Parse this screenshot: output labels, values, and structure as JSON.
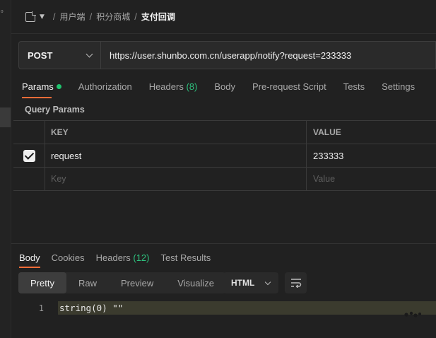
{
  "sidebar": {
    "edge_glyph": "⁰"
  },
  "breadcrumb": {
    "icon": "document-icon",
    "items": [
      "用户端",
      "积分商城",
      "支付回调"
    ],
    "separator": "/"
  },
  "request": {
    "method": "POST",
    "url": "https://user.shunbo.com.cn/userapp/notify?request=233333"
  },
  "request_tabs": [
    {
      "label": "Params",
      "active": true,
      "indicator": "green-dot"
    },
    {
      "label": "Authorization"
    },
    {
      "label": "Headers",
      "count": "(8)"
    },
    {
      "label": "Body"
    },
    {
      "label": "Pre-request Script"
    },
    {
      "label": "Tests"
    },
    {
      "label": "Settings"
    }
  ],
  "params": {
    "section_title": "Query Params",
    "columns": {
      "key": "KEY",
      "value": "VALUE"
    },
    "rows": [
      {
        "checked": true,
        "key": "request",
        "value": "233333"
      }
    ],
    "placeholders": {
      "key": "Key",
      "value": "Value"
    }
  },
  "response_tabs": [
    {
      "label": "Body",
      "active": true
    },
    {
      "label": "Cookies"
    },
    {
      "label": "Headers",
      "count": "(12)"
    },
    {
      "label": "Test Results"
    }
  ],
  "view": {
    "modes": [
      "Pretty",
      "Raw",
      "Preview",
      "Visualize"
    ],
    "active": "Pretty",
    "format": "HTML"
  },
  "response_body": {
    "lines": [
      {
        "number": "1",
        "text": "string(0) \"\""
      }
    ]
  },
  "colors": {
    "accent": "#ff6c37",
    "count_green": "#2ec27e",
    "dot_green": "#1fc36e",
    "background": "#212121"
  }
}
